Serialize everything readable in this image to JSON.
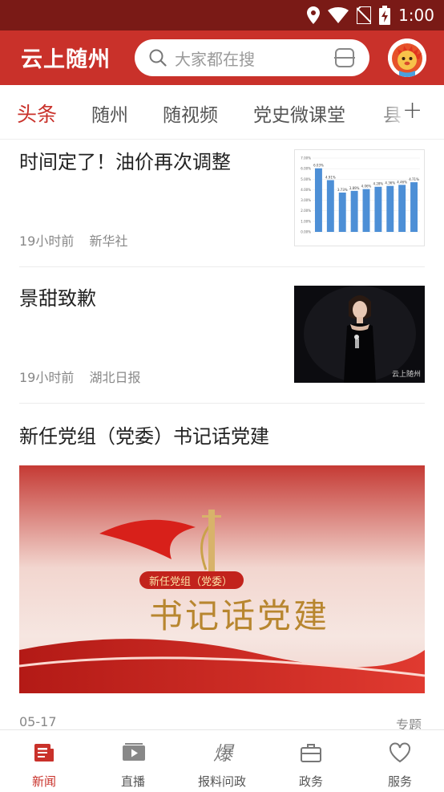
{
  "status_bar": {
    "time": "1:00"
  },
  "header": {
    "logo": "云上随州",
    "search_placeholder": "大家都在搜",
    "accent": "#c9312a"
  },
  "tabs": [
    {
      "label": "头条",
      "active": true
    },
    {
      "label": "随州",
      "active": false
    },
    {
      "label": "随视频",
      "active": false
    },
    {
      "label": "党史微课堂",
      "active": false
    },
    {
      "label": "县",
      "active": false
    }
  ],
  "feed": {
    "items": [
      {
        "title": "时间定了！油价再次调整",
        "time": "19小时前",
        "source": "新华社",
        "thumb": {
          "type": "bar-chart",
          "y_ticks": [
            "7.00%",
            "6.00%",
            "5.00%",
            "4.00%",
            "3.00%",
            "2.00%",
            "1.00%",
            "0.00%"
          ],
          "values": [
            6.03,
            4.91,
            3.73,
            3.89,
            4.06,
            4.28,
            4.36,
            4.46,
            4.71
          ],
          "value_labels": [
            "6.03%",
            "4.91%",
            "3.73%",
            "3.89%",
            "4.06%",
            "4.28%",
            "4.36%",
            "4.46%",
            "4.71%"
          ]
        }
      },
      {
        "title": "景甜致歉",
        "time": "19小时前",
        "source": "湖北日报",
        "thumb": {
          "watermark": "云上随州"
        }
      }
    ],
    "feature": {
      "title": "新任党组（党委）书记话党建",
      "banner_small": "新任党组（党委）",
      "banner_big": "书记话党建",
      "date": "05-17",
      "tag": "专题"
    }
  },
  "bottom_nav": [
    {
      "label": "新闻",
      "icon": "news-icon",
      "active": true
    },
    {
      "label": "直播",
      "icon": "live-icon",
      "active": false
    },
    {
      "label": "报料问政",
      "icon": "report-icon",
      "active": false
    },
    {
      "label": "政务",
      "icon": "briefcase-icon",
      "active": false
    },
    {
      "label": "服务",
      "icon": "heart-icon",
      "active": false
    }
  ]
}
